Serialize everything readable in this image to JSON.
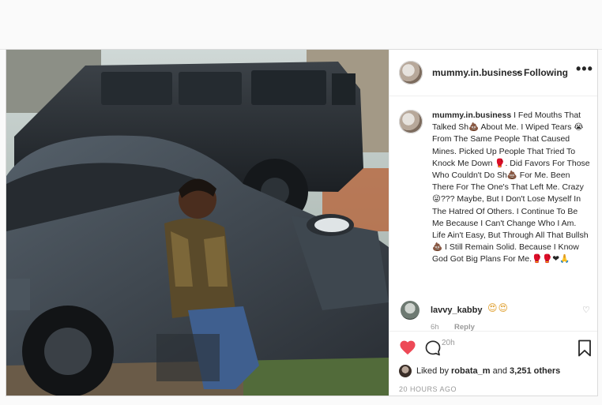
{
  "post": {
    "username": "mummy.in.business",
    "separator": "•",
    "follow_status": "Following",
    "more_label": "•••",
    "caption_user": "mummy.in.business",
    "caption_segments": [
      " I Fed Mouths That Talked Sh",
      " About Me. I Wiped Tears ",
      " From The Same People That Caused Mines. Picked Up People That Tried To Knock Me Down ",
      ". Did Favors For Those Who Couldn't Do Sh",
      " For Me. Been There For The One's That Left Me. Crazy ",
      "??? Maybe, But I Don't Lose Myself In The Hatred Of Others. I Continue To Be Me Because I Can't Change Who I Am. Life Ain't Easy, But Through All That Bullsh",
      " I Still Remain Solid. Because I Know God Got Big Plans For Me."
    ],
    "caption_emojis": [
      "💩",
      "😭",
      "🥊",
      "💩",
      "😜",
      "💩",
      "🥊🥊❤🙏"
    ],
    "caption_time": "20h",
    "comment": {
      "user": "lavvy_kabby",
      "emojis": "😍😍",
      "time": "6h",
      "reply_label": "Reply",
      "like_icon": "♡"
    },
    "likes": {
      "prefix": "Liked by ",
      "user": "robata_m",
      "middle": " and ",
      "count": "3,251 others"
    },
    "timestamp": "20 HOURS AGO"
  },
  "colors": {
    "like_red": "#ed4956",
    "muted_gray": "#999999",
    "border": "#dbdbdb"
  },
  "icons": {
    "like": "heart-icon",
    "comment": "comment-bubble-icon",
    "save": "bookmark-icon",
    "options": "more-options-icon"
  }
}
